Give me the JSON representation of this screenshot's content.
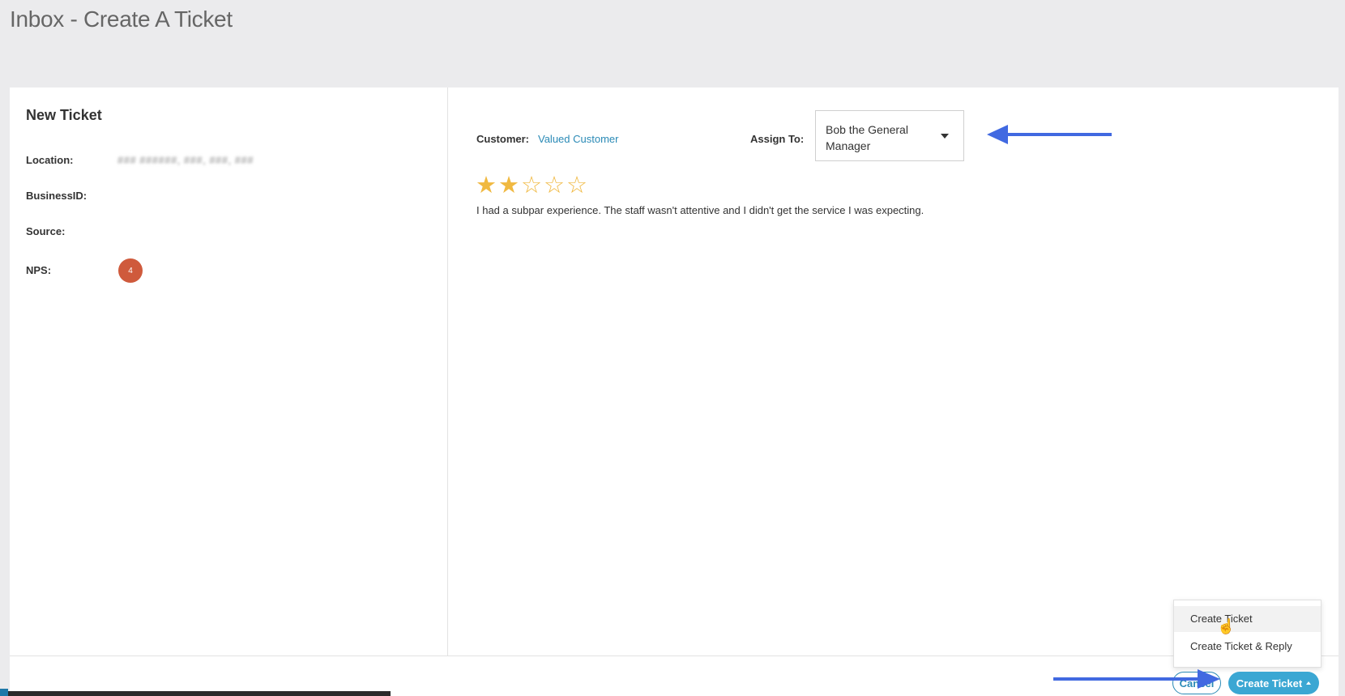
{
  "page": {
    "title": "Inbox - Create A Ticket"
  },
  "left_panel": {
    "title": "New Ticket",
    "fields": [
      {
        "label": "Location:",
        "value": "### ######, ###, ###, ###"
      },
      {
        "label": "BusinessID:",
        "value": ""
      },
      {
        "label": "Source:",
        "value": ""
      },
      {
        "label": "NPS:",
        "value": "4"
      }
    ]
  },
  "review": {
    "customer_label": "Customer:",
    "customer_name": "Valued Customer",
    "assign_label": "Assign To:",
    "assign_value": "Bob the General Manager",
    "rating": 2,
    "max_rating": 5,
    "text": "I had a subpar experience. The staff wasn't attentive and I didn't get the service I was expecting."
  },
  "dropdown": {
    "items": [
      {
        "label": "Create Ticket",
        "active": true
      },
      {
        "label": "Create Ticket & Reply",
        "active": false
      }
    ]
  },
  "footer": {
    "cancel_label": "Cancel",
    "create_label": "Create Ticket"
  },
  "colors": {
    "accent": "#2a8ab6",
    "primary_button": "#3ba7d3",
    "nps_badge": "#cf5a3c",
    "star": "#f0b941",
    "annotation_arrow": "#4169e1"
  },
  "icons": {
    "star_filled": "star-filled-icon",
    "star_empty": "star-empty-icon",
    "caret_down": "chevron-down-icon",
    "caret_up": "chevron-up-icon",
    "cursor": "hand-pointer-icon"
  }
}
